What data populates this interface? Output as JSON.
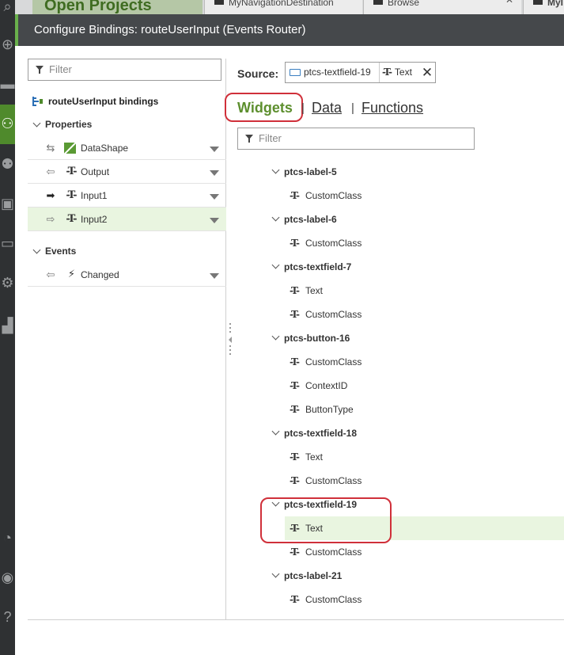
{
  "app": {
    "top_tabs": [
      {
        "label": "Open Projects"
      },
      {
        "label": "MyNavigationDestination"
      },
      {
        "label": "Browse"
      },
      {
        "label": "MyI"
      }
    ]
  },
  "dialog": {
    "title": "Configure Bindings: routeUserInput (Events Router)"
  },
  "left_panel": {
    "filter_placeholder": "Filter",
    "root_label": "routeUserInput bindings",
    "properties_label": "Properties",
    "properties": [
      {
        "label": "DataShape",
        "direction": "bidirectional",
        "type_icon": "datashape-icon",
        "selected": false
      },
      {
        "label": "Output",
        "direction": "outbound",
        "type_icon": "text-type-icon",
        "selected": false
      },
      {
        "label": "Input1",
        "direction": "inbound-bound",
        "type_icon": "text-type-icon",
        "selected": false
      },
      {
        "label": "Input2",
        "direction": "inbound",
        "type_icon": "text-type-icon",
        "selected": true
      }
    ],
    "events_label": "Events",
    "events": [
      {
        "label": "Changed",
        "type_icon": "lightning-icon"
      }
    ]
  },
  "right_panel": {
    "source_label": "Source:",
    "source_widget": "ptcs-textfield-19",
    "source_property": "Text",
    "tabs": {
      "widgets": "Widgets",
      "data": "Data",
      "functions": "Functions",
      "separator": "|"
    },
    "filter_placeholder": "Filter",
    "widgets": [
      {
        "name": "ptcs-label-5",
        "items": [
          "CustomClass"
        ]
      },
      {
        "name": "ptcs-label-6",
        "items": [
          "CustomClass"
        ]
      },
      {
        "name": "ptcs-textfield-7",
        "items": [
          "Text",
          "CustomClass"
        ]
      },
      {
        "name": "ptcs-button-16",
        "items": [
          "CustomClass",
          "ContextID",
          "ButtonType"
        ]
      },
      {
        "name": "ptcs-textfield-18",
        "items": [
          "Text",
          "CustomClass"
        ]
      },
      {
        "name": "ptcs-textfield-19",
        "items": [
          "Text",
          "CustomClass"
        ],
        "selected_item": "Text"
      },
      {
        "name": "ptcs-label-21",
        "items": [
          "CustomClass"
        ]
      }
    ]
  },
  "colors": {
    "accent_green": "#5d8f2e",
    "selected_row": "#e9f5e0",
    "callout_red": "#d0303a",
    "header_bg": "#45484b"
  }
}
